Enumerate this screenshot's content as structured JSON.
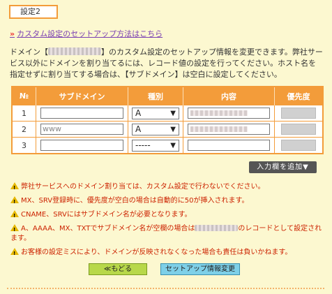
{
  "section": {
    "title": "設定2"
  },
  "guide_link": {
    "arrow": "»",
    "label": "カスタム設定のセットアップ方法はこちら"
  },
  "description": {
    "before": "ドメイン【",
    "after": "】のカスタム設定のセットアップ情報を変更できます。弊社サービス以外にドメインを割り当てるには、レコード値の設定を行ってください。ホスト名を指定せずに割り当てする場合は、【サブドメイン】は空白に設定してください。"
  },
  "table": {
    "headers": [
      "№",
      "サブドメイン",
      "種別",
      "内容",
      "優先度"
    ],
    "rows": [
      {
        "no": "1",
        "subdomain": "",
        "type": "A"
      },
      {
        "no": "2",
        "subdomain": "www",
        "type": "A"
      },
      {
        "no": "3",
        "subdomain": "",
        "type": "-----"
      }
    ]
  },
  "add_rows_button": "入力欄を追加▼",
  "notes": {
    "n1": "弊社サービスへのドメイン割り当ては、カスタム設定で行わないでください。",
    "n2": "MX、SRV登録時に、優先度が空白の場合は自動的に50が挿入されます。",
    "n3": "CNAME、SRVにはサブドメイン名が必要となります。",
    "n4_before": "A、AAAA、MX、TXTでサブドメイン名が空欄の場合は",
    "n4_after": "のレコードとして設定されます。",
    "n5": "お客様の設定ミスにより、ドメインが反映されなくなった場合も責任は負いかねます。"
  },
  "buttons": {
    "back": "≪もどる",
    "submit": "セットアップ情報変更"
  },
  "colors": {
    "accent": "#f39c3a",
    "warning_text": "#cc2200",
    "background": "#fcf8d0"
  }
}
